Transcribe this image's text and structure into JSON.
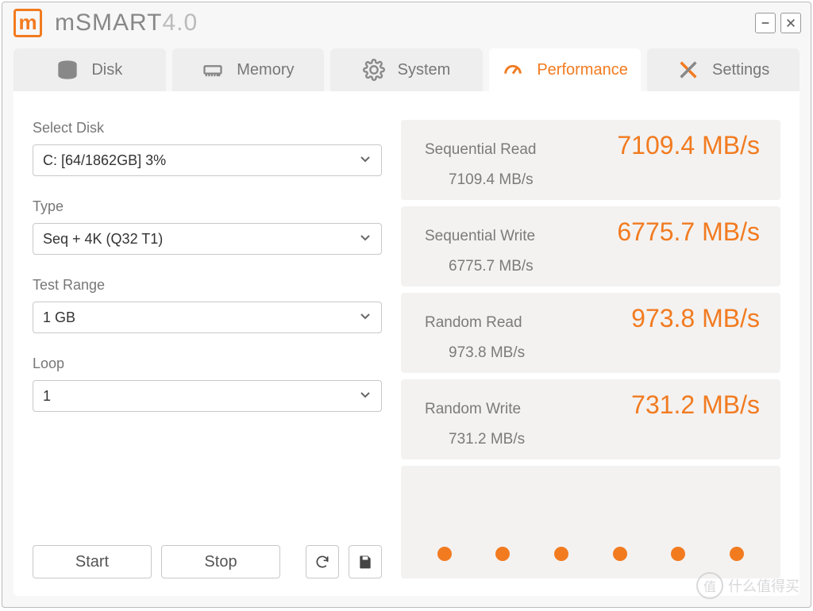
{
  "app": {
    "title_a": "mSMART",
    "title_b": "4",
    "title_c": ".0"
  },
  "tabs": {
    "disk": "Disk",
    "memory": "Memory",
    "system": "System",
    "performance": "Performance",
    "settings": "Settings"
  },
  "form": {
    "select_disk_label": "Select Disk",
    "select_disk_value": "C: [64/1862GB] 3%",
    "type_label": "Type",
    "type_value": "Seq + 4K (Q32 T1)",
    "range_label": "Test Range",
    "range_value": "1 GB",
    "loop_label": "Loop",
    "loop_value": "1",
    "start": "Start",
    "stop": "Stop"
  },
  "metrics": [
    {
      "name": "Sequential Read",
      "big": "7109.4 MB/s",
      "sub": "7109.4 MB/s"
    },
    {
      "name": "Sequential Write",
      "big": "6775.7 MB/s",
      "sub": "6775.7 MB/s"
    },
    {
      "name": "Random Read",
      "big": "973.8 MB/s",
      "sub": "973.8 MB/s"
    },
    {
      "name": "Random Write",
      "big": "731.2 MB/s",
      "sub": "731.2 MB/s"
    }
  ],
  "watermark": "什么值得买"
}
